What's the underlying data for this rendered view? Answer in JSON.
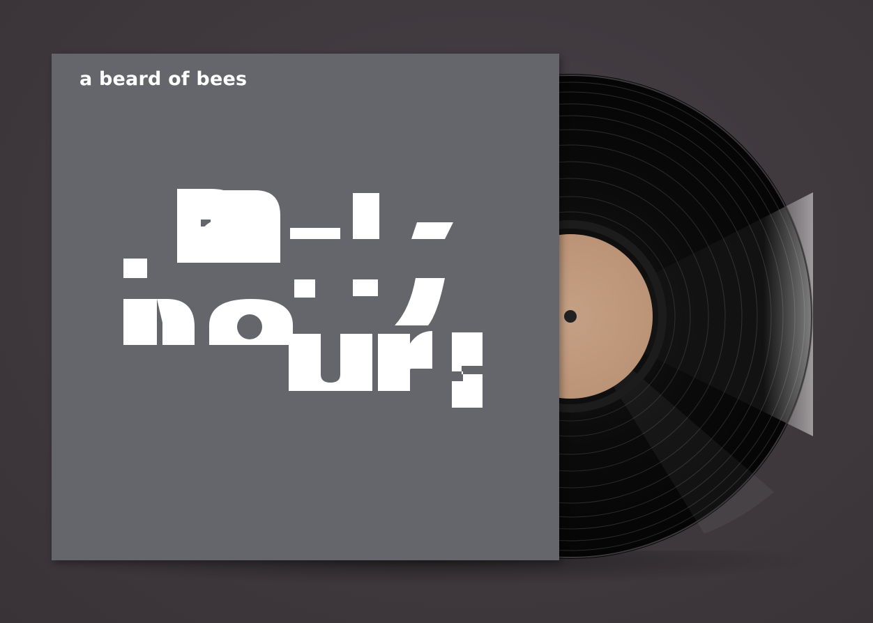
{
  "album": {
    "artist": "a beard of bees",
    "title_line_1": "early",
    "title_line_2": "hours"
  },
  "colors": {
    "background": "#3f393d",
    "sleeve": "#64666b",
    "text": "#ffffff",
    "vinyl": "#0b0b0b",
    "label": "#c29a7e"
  }
}
